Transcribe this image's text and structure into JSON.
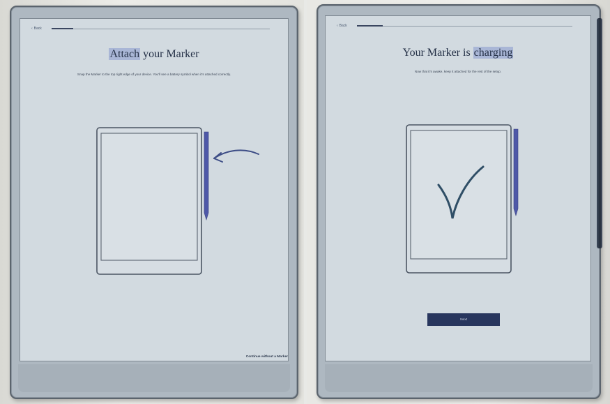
{
  "screen_left": {
    "back_label": "Back",
    "progress_percent": 10,
    "title_highlight": "Attach",
    "title_rest": " your Marker",
    "subtitle": "Snap the Marker to the top right edge of your device. You'll see a battery symbol when it's attached correctly.",
    "footer_link": "Continue without a Marker"
  },
  "screen_right": {
    "back_label": "Back",
    "progress_percent": 12,
    "title_start": "Your Marker is ",
    "title_highlight": "charging",
    "subtitle": "Now that it's awake, keep it attached for the rest of the setup.",
    "next_button": "Next"
  },
  "colors": {
    "accent_blue": "#28365e",
    "highlight": "#a9b6d6",
    "marker_purple": "#4e58a8"
  }
}
